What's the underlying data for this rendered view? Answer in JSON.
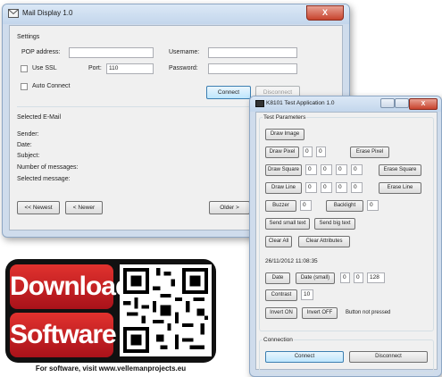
{
  "mail": {
    "title": "Mail Display 1.0",
    "close": "X",
    "settings_label": "Settings",
    "pop_label": "POP address:",
    "pop_value": "",
    "username_label": "Username:",
    "username_value": "",
    "use_ssl_label": "Use SSL",
    "port_label": "Port:",
    "port_value": "110",
    "password_label": "Password:",
    "password_value": "",
    "auto_connect_label": "Auto Connect",
    "connect": "Connect",
    "disconnect": "Disconnect",
    "selected_label": "Selected E-Mail",
    "sender_label": "Sender:",
    "date_label": "Date:",
    "subject_label": "Subject:",
    "num_messages_label": "Number of messages:",
    "selected_message_label": "Selected message:",
    "newest": "<< Newest",
    "newer": "< Newer",
    "older": "Older >"
  },
  "test": {
    "title": "K8101 Test Application 1.0",
    "params_label": "Test Parameters",
    "draw_image": "Draw Image",
    "draw_pixel": "Draw Pixel",
    "draw_pixel_vals": [
      "0",
      "0"
    ],
    "erase_pixel": "Erase Pixel",
    "draw_square": "Draw Square",
    "draw_square_vals": [
      "0",
      "0",
      "0",
      "0"
    ],
    "erase_square": "Erase Square",
    "draw_line": "Draw Line",
    "draw_line_vals": [
      "0",
      "0",
      "0",
      "0"
    ],
    "erase_line": "Erase Line",
    "buzzer": "Buzzer",
    "buzzer_val": "0",
    "backlight": "Backlight",
    "backlight_val": "0",
    "send_small": "Send small text",
    "send_big": "Send big text",
    "clear_all": "Clear All",
    "clear_attr": "Clear Attributes",
    "datetime": "26/11/2012 11:08:35",
    "date": "Date",
    "date_small": "Date (small)",
    "date_vals": [
      "0",
      "0",
      "128"
    ],
    "contrast": "Contrast",
    "contrast_val": "10",
    "invert_on": "Invert ON",
    "invert_off": "Invert OFF",
    "button_status": "Button not pressed",
    "connection_label": "Connection",
    "connect": "Connect",
    "disconnect": "Disconnect"
  },
  "promo": {
    "line1": "Download",
    "line2": "Software",
    "footer": "For software, visit www.vellemanprojects.eu"
  },
  "colors": {
    "accent_blue": "#bee6fd",
    "badge_red": "#c41e22",
    "close_red": "#c7432d"
  }
}
